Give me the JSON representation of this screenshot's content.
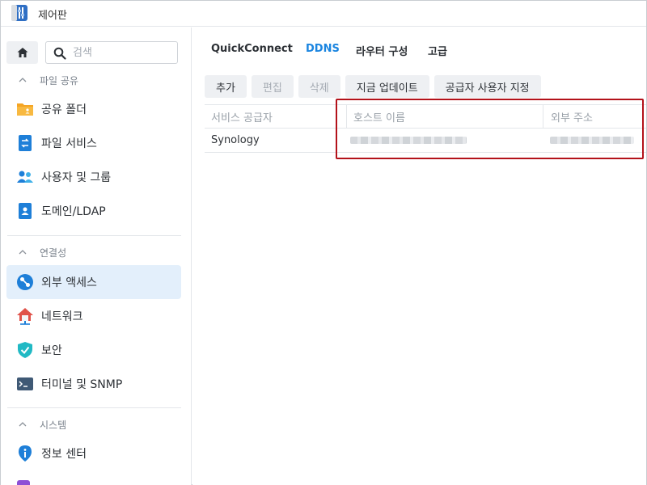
{
  "window": {
    "title": "제어판"
  },
  "sidebar": {
    "search_placeholder": "검색",
    "sections": [
      {
        "label": "파일 공유",
        "items": [
          "공유 폴더",
          "파일 서비스",
          "사용자 및 그룹",
          "도메인/LDAP"
        ]
      },
      {
        "label": "연결성",
        "items": [
          "외부 액세스",
          "네트워크",
          "보안",
          "터미널 및 SNMP"
        ]
      },
      {
        "label": "시스템",
        "items": [
          "정보 센터"
        ]
      }
    ],
    "active_item": "외부 액세스",
    "icons": [
      "folder-icon",
      "file-services-icon",
      "users-icon",
      "domain-icon",
      "external-access-icon",
      "network-icon",
      "security-icon",
      "terminal-icon",
      "info-icon"
    ]
  },
  "tabs": [
    {
      "label": "QuickConnect",
      "active": false
    },
    {
      "label": "DDNS",
      "active": true
    },
    {
      "label": "라우터 구성",
      "active": false
    },
    {
      "label": "고급",
      "active": false
    }
  ],
  "toolbar": {
    "add": "추가",
    "edit": "편집",
    "delete": "삭제",
    "update_now": "지금 업데이트",
    "customize_provider": "공급자 사용자 지정"
  },
  "table": {
    "columns": [
      "서비스 공급자",
      "호스트 이름",
      "외부 주소"
    ],
    "rows": [
      {
        "provider": "Synology"
      }
    ]
  },
  "colors": {
    "accent": "#1b85e0",
    "active_bg": "#e3effb",
    "highlight": "#b3121a"
  }
}
